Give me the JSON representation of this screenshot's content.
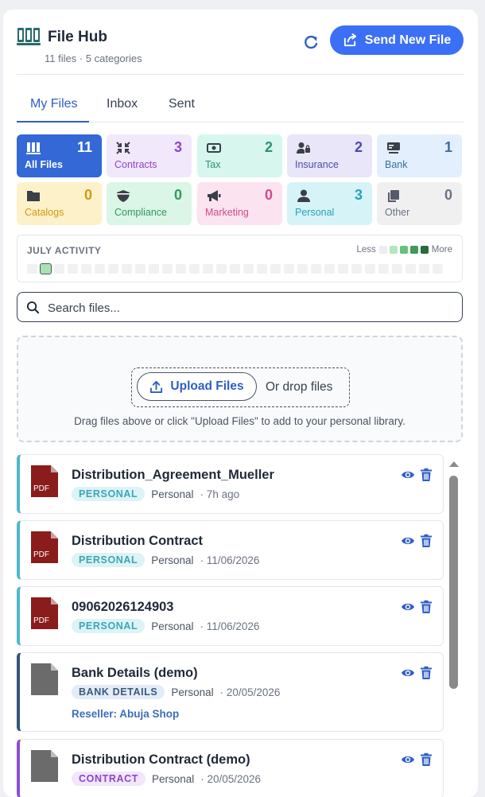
{
  "header": {
    "title": "File Hub",
    "subtitle": "11 files · 5 categories",
    "send_label": "Send New File",
    "accent": "#3b6ff5"
  },
  "tabs": [
    {
      "label": "My Files",
      "active": true
    },
    {
      "label": "Inbox",
      "active": false
    },
    {
      "label": "Sent",
      "active": false
    }
  ],
  "categories": [
    {
      "label": "All Files",
      "count": "11",
      "icon": "books-icon",
      "bg": "#3368d6",
      "fg": "#ffffff",
      "active": true
    },
    {
      "label": "Contracts",
      "count": "3",
      "icon": "compress-icon",
      "bg": "#f1e8fb",
      "fg": "#8e44c9"
    },
    {
      "label": "Tax",
      "count": "2",
      "icon": "money-bill-icon",
      "bg": "#d6f6ee",
      "fg": "#2f8f78"
    },
    {
      "label": "Insurance",
      "count": "2",
      "icon": "user-lock-icon",
      "bg": "#e8e6f8",
      "fg": "#4d4aa8"
    },
    {
      "label": "Bank",
      "count": "1",
      "icon": "money-check-icon",
      "bg": "#e3effc",
      "fg": "#3a6ea8"
    },
    {
      "label": "Catalogs",
      "count": "0",
      "icon": "folder-icon",
      "bg": "#fdf1c9",
      "fg": "#d09a11"
    },
    {
      "label": "Compliance",
      "count": "0",
      "icon": "shield-icon",
      "bg": "#dbf5e6",
      "fg": "#2f9a5e"
    },
    {
      "label": "Marketing",
      "count": "0",
      "icon": "bullhorn-icon",
      "bg": "#fbe3ef",
      "fg": "#d04b8a"
    },
    {
      "label": "Personal",
      "count": "3",
      "icon": "user-icon",
      "bg": "#d6f3f7",
      "fg": "#2aa2b8"
    },
    {
      "label": "Other",
      "count": "0",
      "icon": "copy-icon",
      "bg": "#f0f0f1",
      "fg": "#6b7280"
    }
  ],
  "activity": {
    "title": "JULY ACTIVITY",
    "legend_less": "Less",
    "legend_more": "More",
    "legend_colors": [
      "#eceef1",
      "#b4e5bd",
      "#63c27c",
      "#3f9a59",
      "#2a6a3f"
    ],
    "levels": [
      0,
      1,
      0,
      0,
      0,
      0,
      0,
      0,
      0,
      0,
      0,
      0,
      0,
      0,
      0,
      0,
      0,
      0,
      0,
      0,
      0,
      0,
      0,
      0,
      0,
      0,
      0,
      0,
      0,
      0,
      0
    ]
  },
  "search": {
    "placeholder": "Search files..."
  },
  "upload": {
    "button_label": "Upload Files",
    "drop_text": "Or drop files",
    "hint": "Drag files above or click \"Upload Files\" to add to your personal library."
  },
  "files": [
    {
      "name": "Distribution_Agreement_Mueller",
      "tag": "PERSONAL",
      "owner": "Personal",
      "when": "· 7h ago",
      "type": "pdf",
      "border": "#4fb8c9",
      "tag_bg": "#ddf3f6",
      "tag_fg": "#3aa6b8"
    },
    {
      "name": "Distribution Contract",
      "tag": "PERSONAL",
      "owner": "Personal",
      "when": "· 11/06/2026",
      "type": "pdf",
      "border": "#4fb8c9",
      "tag_bg": "#ddf3f6",
      "tag_fg": "#3aa6b8"
    },
    {
      "name": "09062026124903",
      "tag": "PERSONAL",
      "owner": "Personal",
      "when": "· 11/06/2026",
      "type": "pdf",
      "border": "#4fb8c9",
      "tag_bg": "#ddf3f6",
      "tag_fg": "#3aa6b8"
    },
    {
      "name": "Bank Details (demo)",
      "tag": "BANK DETAILS",
      "owner": "Personal",
      "when": "· 20/05/2026",
      "type": "doc",
      "border": "#34557a",
      "tag_bg": "#e3ecf7",
      "tag_fg": "#3b5a7e",
      "reseller": "Reseller: Abuja Shop"
    },
    {
      "name": "Distribution Contract (demo)",
      "tag": "CONTRACT",
      "owner": "Personal",
      "when": "· 20/05/2026",
      "type": "doc",
      "border": "#8e4fd1",
      "tag_bg": "#f1e6fb",
      "tag_fg": "#8e44c9"
    }
  ],
  "file_type_label": "PDF"
}
